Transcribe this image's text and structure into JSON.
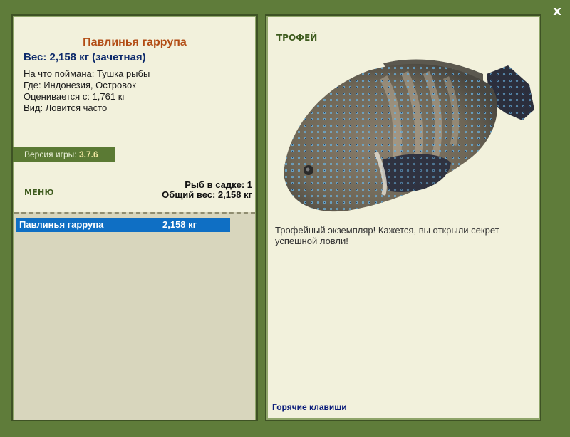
{
  "close": {
    "label": "x",
    "icon": "close-icon"
  },
  "fish": {
    "name": "Павлинья гаррупа",
    "weight_line": "Вес: 2,158 кг (зачетная)",
    "caught_on": "На что поймана: Тушка рыбы",
    "location": "Где: Индонезия, Островок",
    "rated_from": "Оценивается с: 1,761 кг",
    "frequency": "Вид: Ловится часто"
  },
  "version": {
    "label": "Версия игры: ",
    "value": "3.7.6"
  },
  "menu": {
    "label": "МЕНЮ"
  },
  "keepnet": {
    "count_line": "Рыб в садке: 1",
    "total_line": "Общий вес: 2,158 кг"
  },
  "fish_list": [
    {
      "name": "Павлинья гаррупа",
      "weight": "2,158 кг",
      "selected": true
    }
  ],
  "trophy": {
    "heading": "ТРОФЕЙ",
    "text": "Трофейный экземпляр! Кажется, вы открыли секрет успешной ловли!"
  },
  "hotkeys": {
    "label": "Горячие клавиши"
  },
  "colors": {
    "frame": "#5f7c3a",
    "panel": "#f2f1dc",
    "title": "#b24c14",
    "selection": "#0f6fc4"
  }
}
